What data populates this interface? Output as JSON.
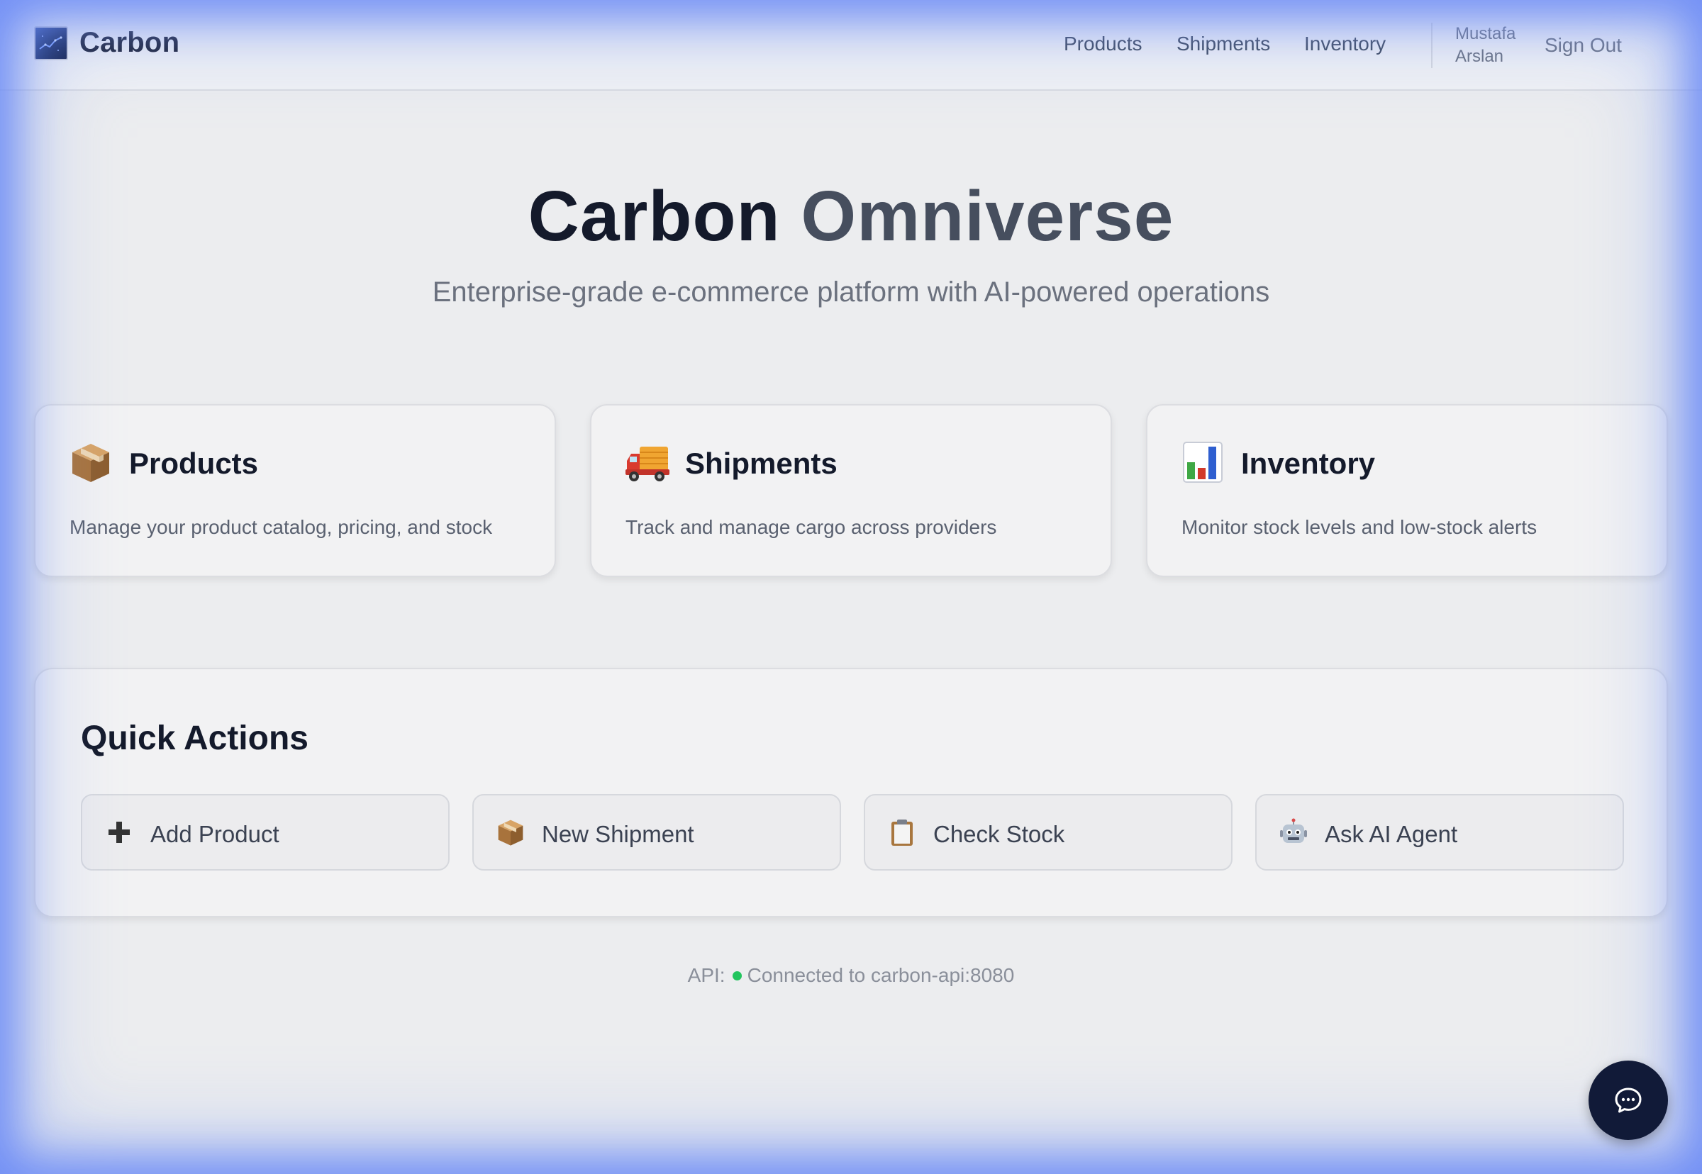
{
  "header": {
    "brand": "Carbon",
    "nav": [
      "Products",
      "Shipments",
      "Inventory"
    ],
    "user_first": "Mustafa",
    "user_last": "Arslan",
    "sign_out": "Sign Out"
  },
  "hero": {
    "title_part1": "Carbon",
    "title_part2": "Omniverse",
    "subtitle": "Enterprise-grade e-commerce platform with AI-powered operations"
  },
  "cards": [
    {
      "icon": "package-icon",
      "title": "Products",
      "desc": "Manage your product catalog, pricing, and stock"
    },
    {
      "icon": "truck-icon",
      "title": "Shipments",
      "desc": "Track and manage cargo across providers"
    },
    {
      "icon": "bar-chart-icon",
      "title": "Inventory",
      "desc": "Monitor stock levels and low-stock alerts"
    }
  ],
  "quick_actions": {
    "title": "Quick Actions",
    "buttons": [
      {
        "icon": "plus-icon",
        "label": "Add Product"
      },
      {
        "icon": "package-icon",
        "label": "New Shipment"
      },
      {
        "icon": "clipboard-icon",
        "label": "Check Stock"
      },
      {
        "icon": "robot-icon",
        "label": "Ask AI Agent"
      }
    ]
  },
  "status": {
    "prefix": "API:",
    "text": "Connected to carbon-api:8080",
    "color": "#22c55e"
  },
  "chat": {
    "icon": "chat-bubble-icon"
  },
  "colors": {
    "accent_dark": "#111a38",
    "glow": "#6e8cf5"
  }
}
